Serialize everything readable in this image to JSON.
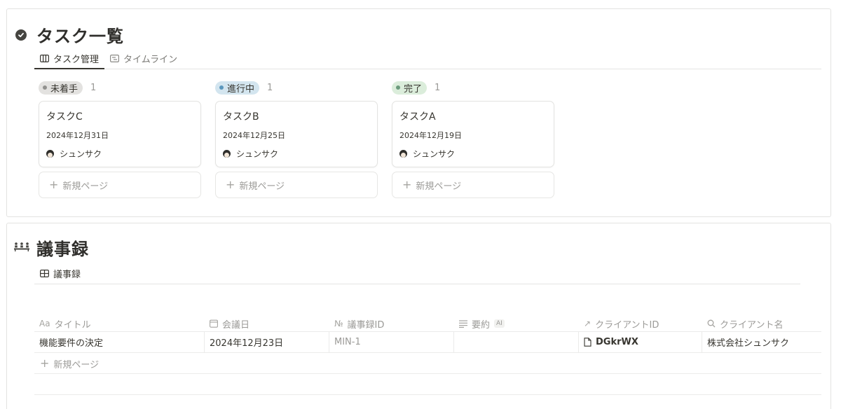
{
  "tasks": {
    "title": "タスク一覧",
    "tabs": [
      {
        "label": "タスク管理",
        "icon": "board-icon",
        "active": true
      },
      {
        "label": "タイムライン",
        "icon": "timeline-icon",
        "active": false
      }
    ],
    "columns": [
      {
        "status": "未着手",
        "count": "1",
        "pill_bg": "#e3e2e0",
        "dot": "#91918e",
        "card": {
          "title": "タスクC",
          "date": "2024年12月31日",
          "owner": "シュンサク"
        }
      },
      {
        "status": "進行中",
        "count": "1",
        "pill_bg": "#d3e5ef",
        "dot": "#5b97bd",
        "card": {
          "title": "タスクB",
          "date": "2024年12月25日",
          "owner": "シュンサク"
        }
      },
      {
        "status": "完了",
        "count": "1",
        "pill_bg": "#dbeddb",
        "dot": "#6c9b7d",
        "card": {
          "title": "タスクA",
          "date": "2024年12月19日",
          "owner": "シュンサク"
        }
      }
    ],
    "new_page_label": "新規ページ"
  },
  "minutes": {
    "title": "議事録",
    "tab_label": "議事録",
    "columns": [
      {
        "icon": "Aa",
        "label": "タイトル"
      },
      {
        "icon": "calendar-icon",
        "label": "会議日"
      },
      {
        "icon": "№",
        "label": "議事録ID"
      },
      {
        "icon": "text-lines-icon",
        "label": "要約",
        "badge": "AI"
      },
      {
        "icon": "↗",
        "label": "クライアントID"
      },
      {
        "icon": "search-icon",
        "label": "クライアント名"
      }
    ],
    "rows": [
      {
        "title": "機能要件の決定",
        "date": "2024年12月23日",
        "minutes_id": "MIN-1",
        "summary": "",
        "client_id": "DGkrWX",
        "client_name": "株式会社シュンサク"
      }
    ],
    "new_page_label": "新規ページ"
  }
}
